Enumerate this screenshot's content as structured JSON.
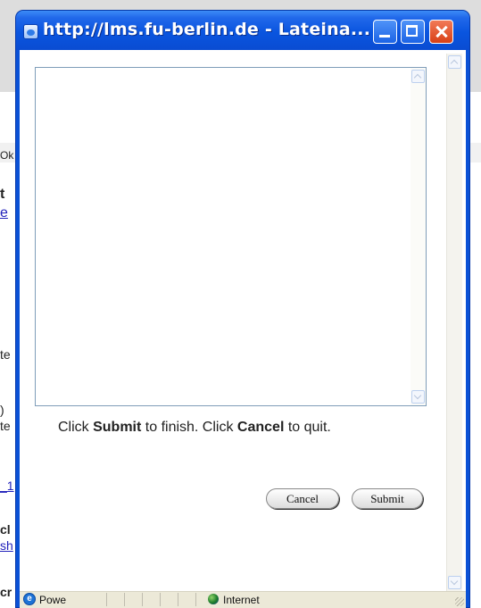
{
  "background_page": {
    "fragments": [
      "Ok",
      "t",
      "e",
      "te",
      ")",
      "te",
      "_1",
      "cl",
      "sh",
      "cr"
    ]
  },
  "window": {
    "title": "http://lms.fu-berlin.de - Lateina...",
    "buttons": {
      "minimize": "minimize",
      "maximize": "maximize",
      "close": "close"
    }
  },
  "form": {
    "textarea_value": "",
    "instruction": {
      "part1": "Click ",
      "submit_word": "Submit",
      "part2": " to finish. Click ",
      "cancel_word": "Cancel",
      "part3": " to quit."
    },
    "cancel_label": "Cancel",
    "submit_label": "Submit"
  },
  "statusbar": {
    "status_text": "Powe",
    "zone": "Internet"
  },
  "colors": {
    "titlebar": "#0a55df",
    "close_button": "#d84016",
    "statusbar": "#ece9d8"
  }
}
